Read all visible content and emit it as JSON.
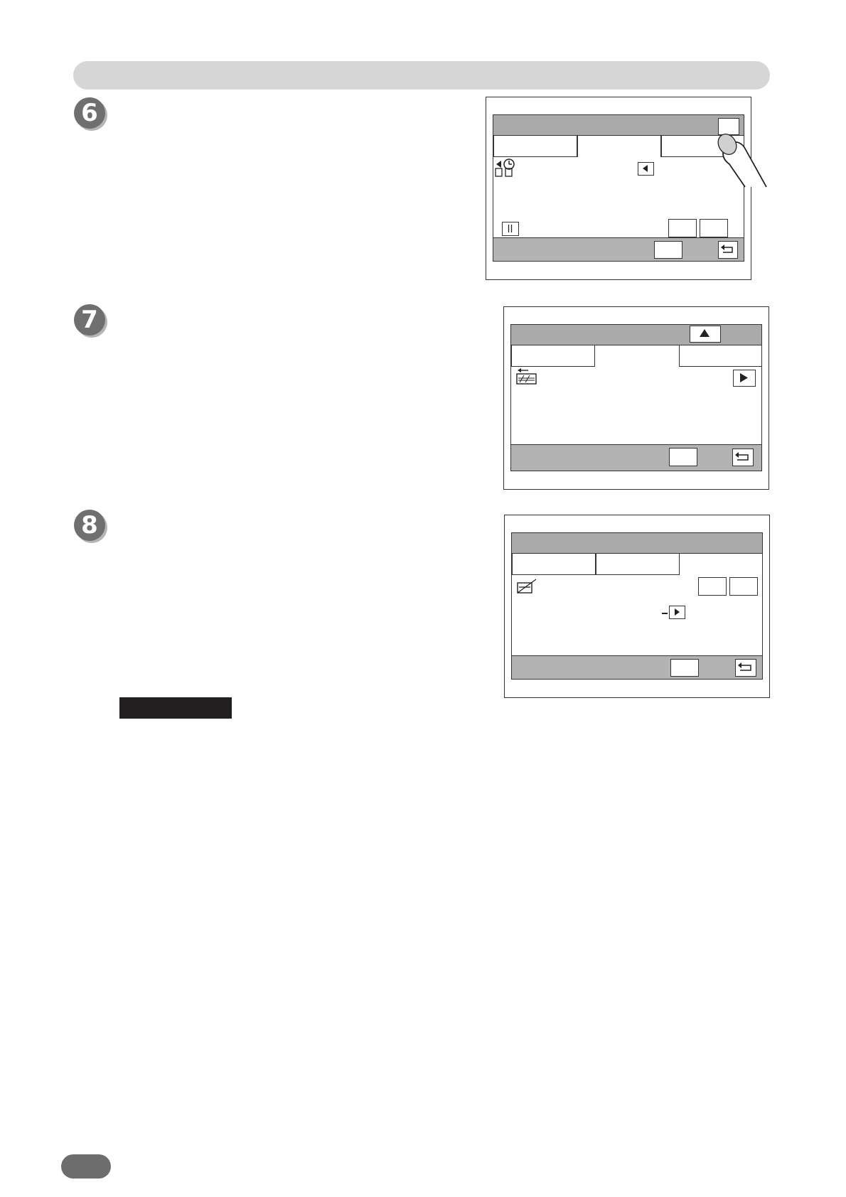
{
  "steps": [
    {
      "number": "6"
    },
    {
      "number": "7"
    },
    {
      "number": "8"
    }
  ],
  "icons": {
    "step6": [
      "sort-mode-icon",
      "left-arrow-icon",
      "pause-icon",
      "return-icon",
      "finger-icon"
    ],
    "step7": [
      "up-arrow-icon",
      "ruler-icon",
      "right-arrow-icon",
      "return-icon"
    ],
    "step8": [
      "edge-icon",
      "right-arrow-icon",
      "return-icon"
    ]
  },
  "colors": {
    "header_bar": "#d6d6d6",
    "step_circle": "#6f6f6f",
    "screen_title_bar": "#aaaaaa",
    "screen_footer": "#b3b3b3",
    "note_label": "#231f20",
    "page_pill": "#6d6d6d"
  }
}
